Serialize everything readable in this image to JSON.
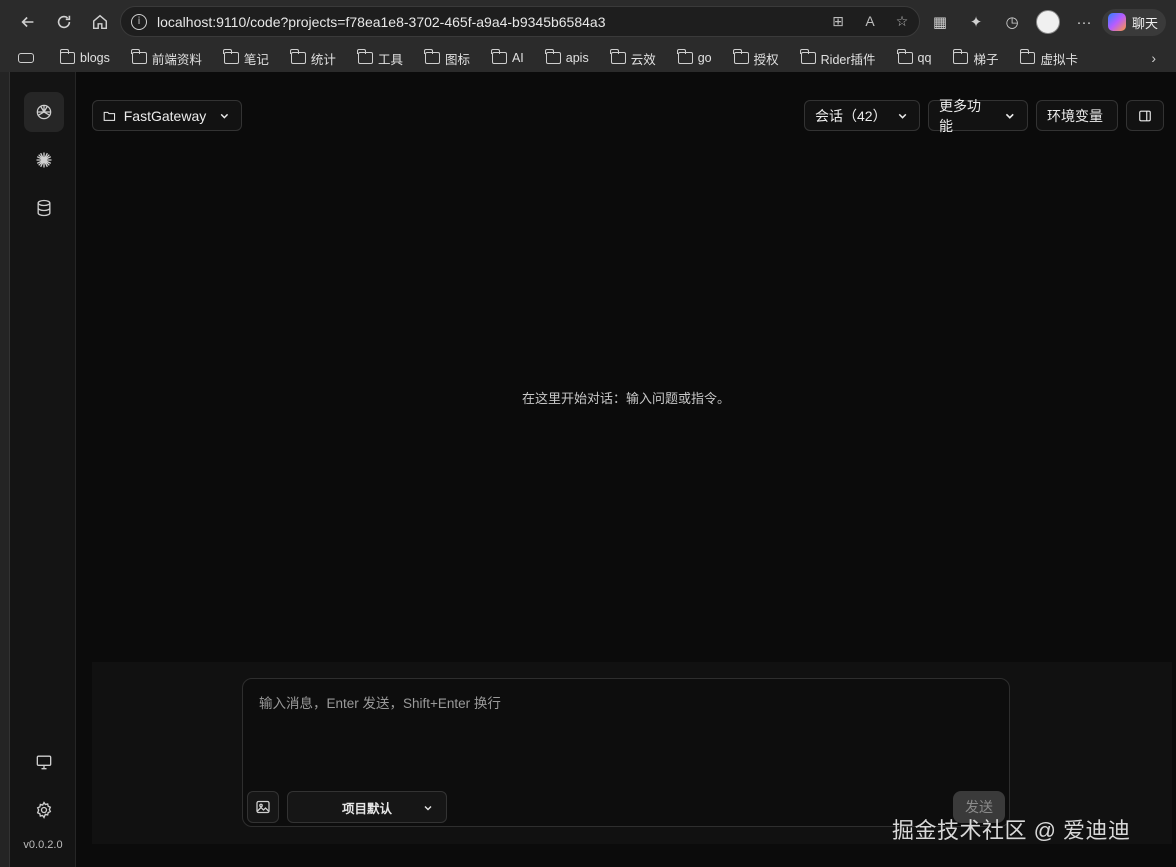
{
  "browser": {
    "url": "localhost:9110/code?projects=f78ea1e8-3702-465f-a9a4-b9345b6584a3",
    "chat_label": "聊天",
    "more_label": "···"
  },
  "bookmarks": [
    "blogs",
    "前端资料",
    "笔记",
    "统计",
    "工具",
    "图标",
    "AI",
    "apis",
    "云效",
    "go",
    "授权",
    "Rider插件",
    "qq",
    "梯子",
    "虚拟卡"
  ],
  "sidebar": {
    "version": "v0.0.2.0"
  },
  "toolbar": {
    "project": "FastGateway",
    "sessions": "会话（42）",
    "more_features": "更多功能",
    "env_vars": "环境变量"
  },
  "main": {
    "empty_hint": "在这里开始对话：输入问题或指令。"
  },
  "composer": {
    "placeholder": "输入消息，Enter 发送，Shift+Enter 换行",
    "model": "项目默认",
    "send": "发送"
  },
  "watermark": "掘金技术社区 @ 爱迪迪"
}
